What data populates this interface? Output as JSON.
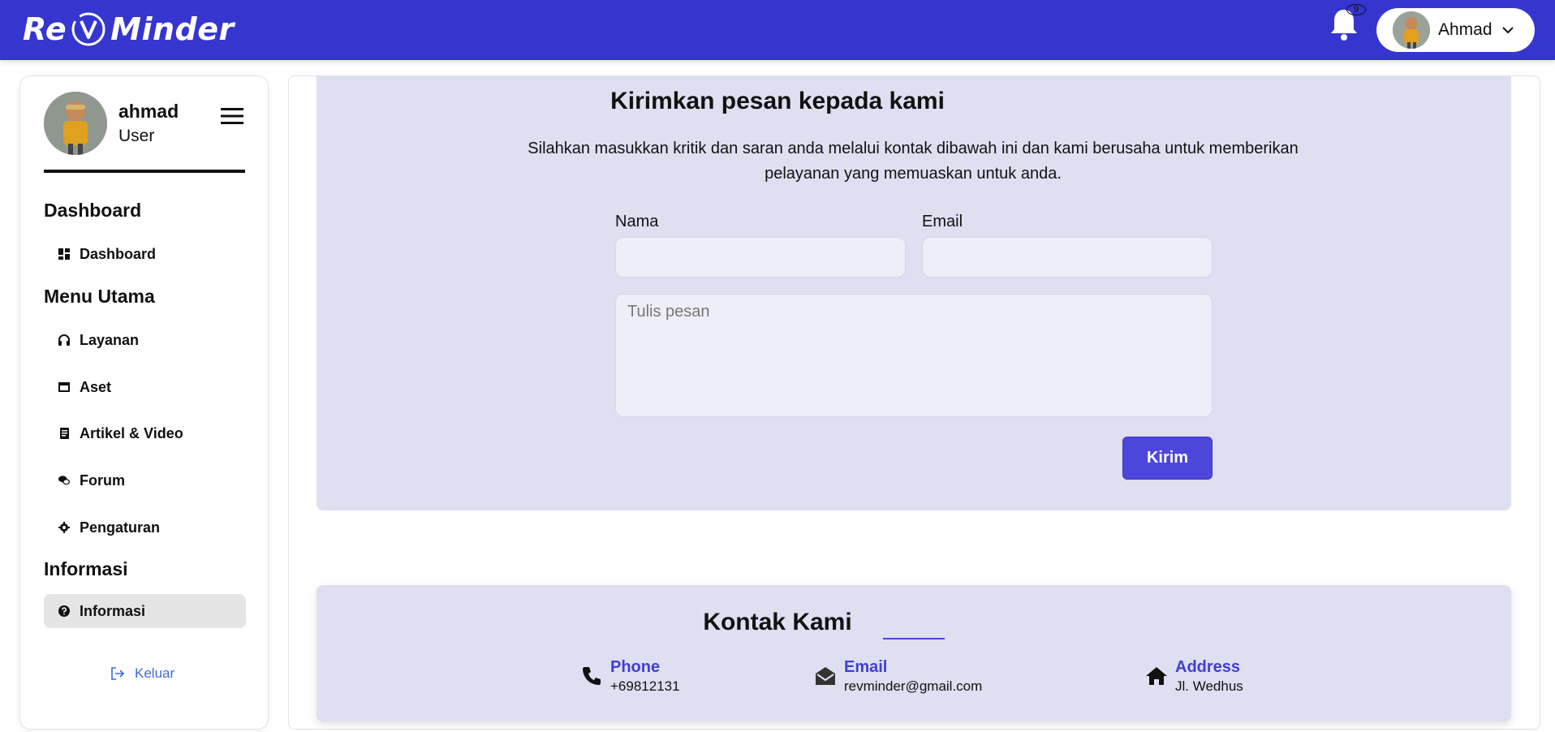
{
  "header": {
    "logo_text_left": "Re",
    "logo_text_right": "Minder",
    "notification_count": "9",
    "user_name": "Ahmad",
    "brand_color": "#3535d0"
  },
  "sidebar": {
    "profile_name": "ahmad",
    "profile_role": "User",
    "sections": [
      {
        "heading": "Dashboard",
        "items": [
          {
            "label": "Dashboard",
            "icon": "dashboard-icon"
          }
        ]
      },
      {
        "heading": "Menu Utama",
        "items": [
          {
            "label": "Layanan",
            "icon": "headphones-icon"
          },
          {
            "label": "Aset",
            "icon": "window-icon"
          },
          {
            "label": "Artikel & Video",
            "icon": "document-icon"
          },
          {
            "label": "Forum",
            "icon": "chat-icon"
          },
          {
            "label": "Pengaturan",
            "icon": "gear-icon"
          }
        ]
      },
      {
        "heading": "Informasi",
        "items": [
          {
            "label": "Informasi",
            "icon": "question-circle-icon",
            "active": true
          }
        ]
      }
    ],
    "logout_label": "Keluar"
  },
  "form": {
    "title": "Kirimkan pesan kepada kami",
    "description": "Silahkan masukkan kritik dan saran anda melalui kontak dibawah ini dan kami berusaha untuk memberikan pelayanan yang memuaskan untuk anda.",
    "name_label": "Nama",
    "name_value": "",
    "email_label": "Email",
    "email_value": "",
    "message_placeholder": "Tulis pesan",
    "submit_label": "Kirim"
  },
  "contact": {
    "title": "Kontak Kami",
    "items": [
      {
        "label": "Phone",
        "value": "+69812131",
        "icon": "phone-icon"
      },
      {
        "label": "Email",
        "value": "revminder@gmail.com",
        "icon": "envelope-open-icon"
      },
      {
        "label": "Address",
        "value": "Jl. Wedhus",
        "icon": "home-icon"
      }
    ]
  }
}
